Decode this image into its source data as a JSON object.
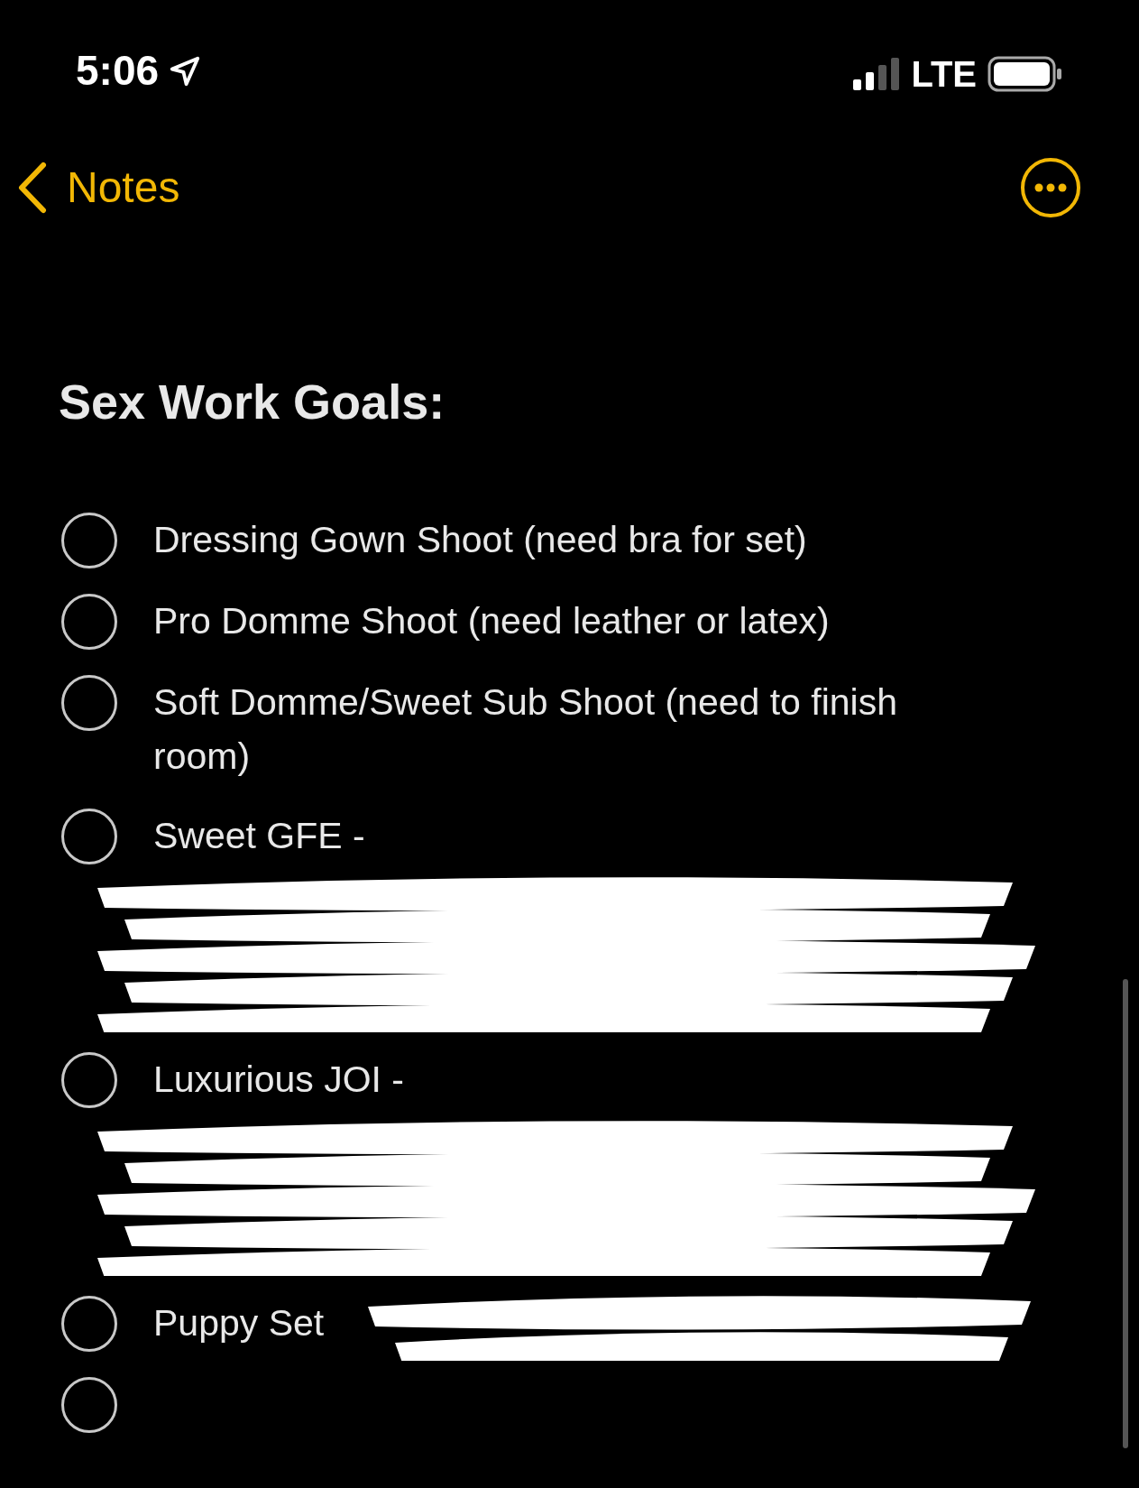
{
  "status_bar": {
    "time": "5:06",
    "network": "LTE"
  },
  "nav": {
    "back_label": "Notes"
  },
  "note": {
    "title": "Sex Work Goals:",
    "items": [
      {
        "kind": "plain",
        "text": "Dressing Gown Shoot (need bra for set)",
        "checked": false
      },
      {
        "kind": "plain",
        "text": "Pro Domme Shoot (need leather or latex)",
        "checked": false
      },
      {
        "kind": "plain",
        "text": "Soft Domme/Sweet Sub Shoot (need to finish room)",
        "checked": false
      },
      {
        "kind": "redacted-link",
        "text": "Sweet GFE - ",
        "checked": false
      },
      {
        "kind": "redacted-link",
        "text": "Luxurious JOI - ",
        "checked": false
      },
      {
        "kind": "redacted-note",
        "text": "Puppy Set",
        "checked": false
      },
      {
        "kind": "plain",
        "checked": false
      }
    ]
  }
}
